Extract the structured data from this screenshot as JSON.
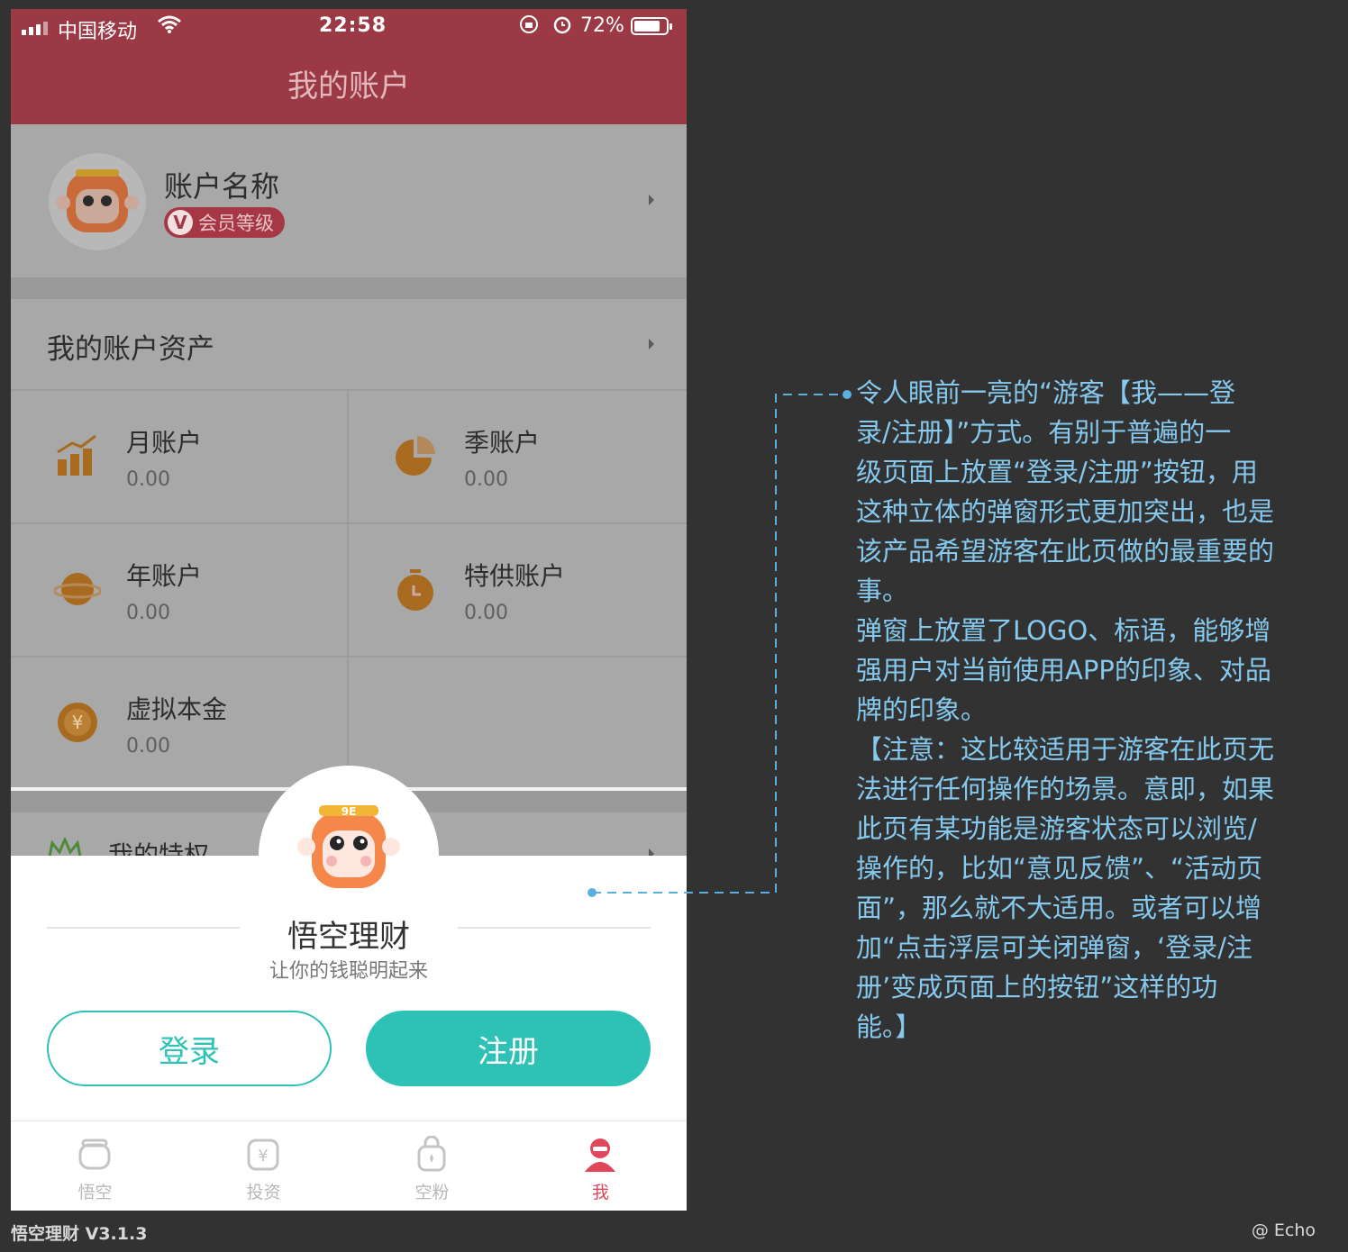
{
  "status_bar": {
    "carrier": "中国移动",
    "time": "22:58",
    "battery": "72%"
  },
  "nav": {
    "title": "我的账户"
  },
  "profile": {
    "name": "账户名称",
    "vip_label": "会员等级"
  },
  "assets": {
    "header": "我的账户资产",
    "items": [
      {
        "name": "月账户",
        "value": "0.00",
        "icon": "bar-chart-icon"
      },
      {
        "name": "季账户",
        "value": "0.00",
        "icon": "pie-chart-icon"
      },
      {
        "name": "年账户",
        "value": "0.00",
        "icon": "planet-icon"
      },
      {
        "name": "特供账户",
        "value": "0.00",
        "icon": "stopwatch-icon"
      },
      {
        "name": "虚拟本金",
        "value": "0.00",
        "icon": "yen-coin-icon"
      }
    ]
  },
  "privilege": {
    "label": "我的特权"
  },
  "popup": {
    "brand": "悟空理财",
    "slogan": "让你的钱聪明起来",
    "login": "登录",
    "register": "注册"
  },
  "tabs": [
    {
      "label": "悟空",
      "icon": "wukong-tab-icon"
    },
    {
      "label": "投资",
      "icon": "invest-tab-icon"
    },
    {
      "label": "空粉",
      "icon": "fans-tab-icon"
    },
    {
      "label": "我",
      "icon": "me-tab-icon"
    }
  ],
  "footer": {
    "app_version": "悟空理财 V3.1.3",
    "credit": "@ Echo"
  },
  "annotation": {
    "lines": [
      "令人眼前一亮的“游客【我——登",
      "录/注册】”方式。有别于普遍的一",
      "级页面上放置“登录/注册”按钮，用",
      "这种立体的弹窗形式更加突出，也是",
      "该产品希望游客在此页做的最重要的",
      "事。",
      "弹窗上放置了LOGO、标语，能够增",
      "强用户对当前使用APP的印象、对品",
      "牌的印象。",
      "【注意：这比较适用于游客在此页无",
      "法进行任何操作的场景。意即，如果",
      "此页有某功能是游客状态可以浏览/",
      "操作的，比如“意见反馈”、“活动页",
      "面”，那么就不大适用。或者可以增",
      "加“点击浮层可关闭弹窗，‘登录/注",
      "册’变成页面上的按钮”这样的功",
      "能。】"
    ]
  },
  "colors": {
    "header_red": "#9b3a45",
    "teal": "#2ec2b6",
    "active_tab": "#e0475a",
    "annotation": "#86c9ef",
    "asset_icon": "#d08a2c"
  }
}
